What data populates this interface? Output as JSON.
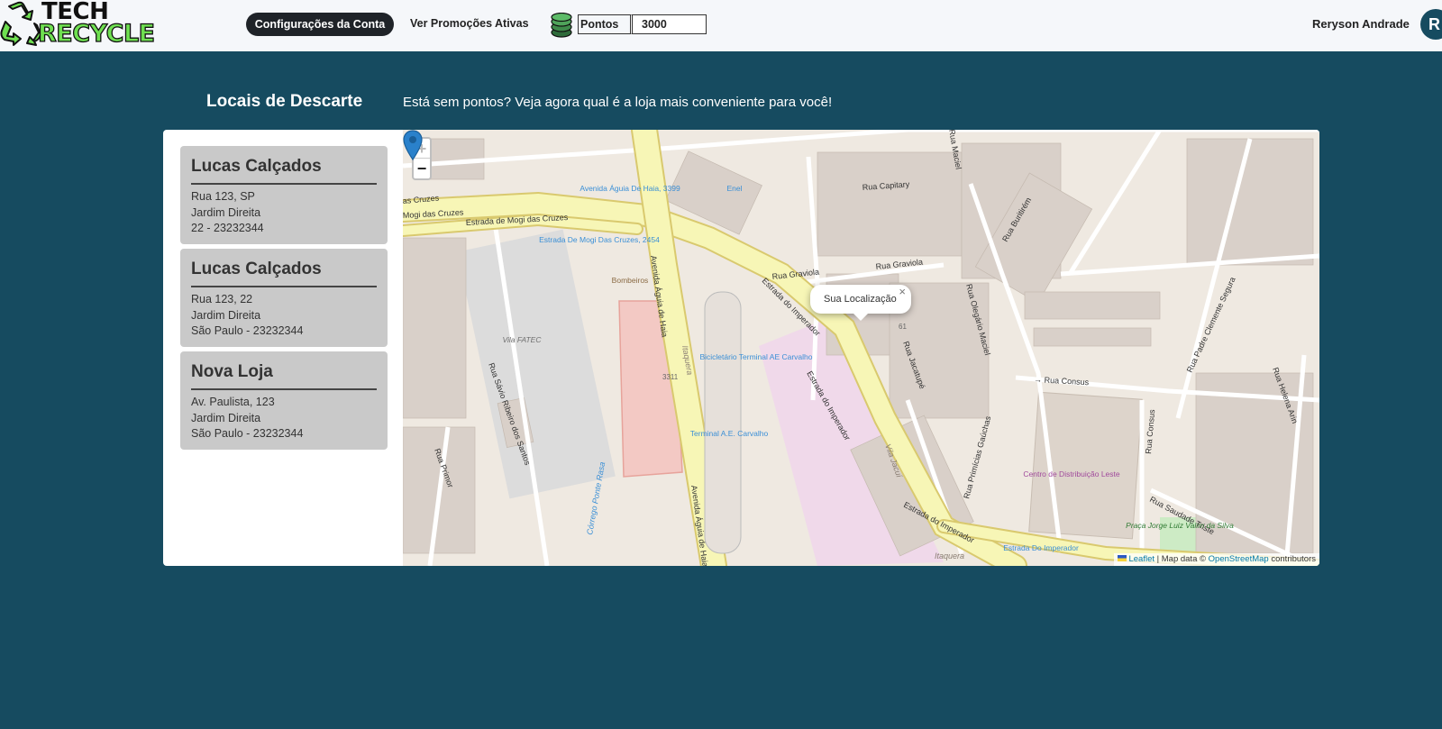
{
  "header": {
    "logo_line1": "TECH",
    "logo_line2": "RECYCLE",
    "nav_account": "Configurações da Conta",
    "nav_promos": "Ver Promoções Ativas",
    "points_label": "Pontos",
    "points_value": "3000",
    "user_name": "Reryson Andrade",
    "avatar_initial": "R"
  },
  "page": {
    "title": "Locais de Descarte",
    "subtitle": "Está sem pontos? Veja agora qual é a loja mais conveniente para você!"
  },
  "stores": [
    {
      "name": "Lucas Calçados",
      "line1": "Rua 123, SP",
      "line2": "Jardim Direita",
      "line3": "22 - 23232344"
    },
    {
      "name": "Lucas Calçados",
      "line1": "Rua 123, 22",
      "line2": "Jardim Direita",
      "line3": "São Paulo - 23232344"
    },
    {
      "name": "Nova Loja",
      "line1": "Av. Paulista, 123",
      "line2": "Jardim Direita",
      "line3": "São Paulo - 23232344"
    }
  ],
  "map": {
    "zoom_in": "+",
    "zoom_out": "−",
    "popup_text": "Sua Localização",
    "popup_close": "×",
    "attrib_leaflet": "Leaflet",
    "attrib_mid": " | Map data © ",
    "attrib_osm": "OpenStreetMap",
    "attrib_end": " contributors",
    "labels": {
      "cruzes_1": "as Cruzes",
      "cruzes_2": "Mogi das Cruzes",
      "estrada_mogi": "Estrada de Mogi das Cruzes",
      "aguia_haia_1": "Avenida Águia de Haia",
      "aguia_haia_2": "Avenida Águia de Haia",
      "bus_aguia": "Avenida Águia De Haia, 3399",
      "bus_estrada": "Estrada De Mogi Das Cruzes, 2454",
      "bombeiros": "Bombeiros",
      "vila_fatec": "Vila FATEC",
      "rua_savio": "Rua Sávio Ribeiro dos Santos",
      "rua_primor": "Rua Primor",
      "corrego": "Córrego Ponte Rasa",
      "number_3311": "3311",
      "itaquera": "Itaquera",
      "bicicletario": "Bicicletário Terminal AE Carvalho",
      "terminal": "Terminal A.E. Carvalho",
      "enel": "Enel",
      "rua_capitary": "Rua Capitary",
      "rua_graviola_1": "Rua Graviola",
      "rua_graviola_2": "Rua Graviola",
      "estrada_imp_1": "Estrada do Imperador",
      "estrada_imp_2": "Estrada do Imperador",
      "estrada_imp_3": "Estrada do Imperador",
      "rua_jacatupe": "Rua Jacatupé",
      "vila_jacui": "Vila Jacuí",
      "rua_oleg": "Rua Olegário Maciel",
      "rua_oleg_top": "Rua Maciel",
      "rua_buriti": "Rua Buritirém",
      "rua_consus_1": "→ Rua Consus",
      "rua_consus_2": "Rua Consus",
      "rua_gauchas": "Rua Primícias Gaúchas",
      "centro_dist": "Centro de Distribuição Leste",
      "rua_clemente": "Rua Padre Clemente Segura",
      "rua_helena": "Rua Helena Arin",
      "rua_saudade": "Rua Saudade Triste",
      "praca": "Praça Jorge Luiz Valim da Silva",
      "estrada_bus": "Estrada Do Imperador",
      "itaquera_2": "Itaquera",
      "num_61": "61"
    }
  },
  "colors": {
    "background": "#164b60",
    "header_bg": "#f5f7fa",
    "card_bg": "#c9c9c9",
    "logo_green": "#6fe051",
    "road_yellow": "#f7f6b6",
    "marker_blue": "#2a81cb"
  }
}
